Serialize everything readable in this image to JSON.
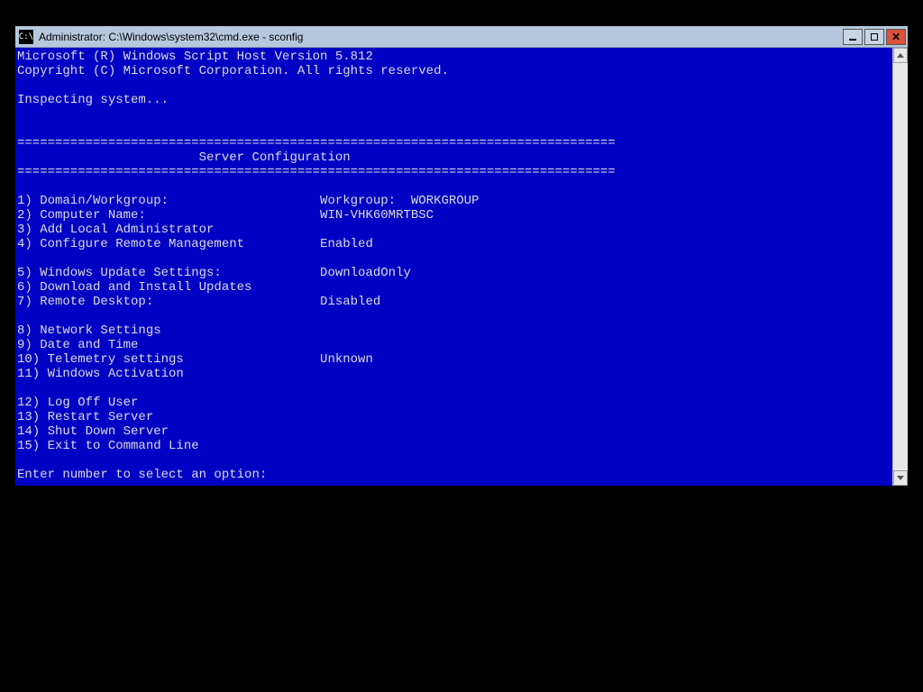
{
  "window": {
    "title": "Administrator: C:\\Windows\\system32\\cmd.exe - sconfig",
    "icon_label": "C:\\"
  },
  "header": {
    "line1": "Microsoft (R) Windows Script Host Version 5.812",
    "line2": "Copyright (C) Microsoft Corporation. All rights reserved."
  },
  "inspecting": "Inspecting system...",
  "divider": "===============================================================================",
  "banner_title_padded": "                        Server Configuration",
  "menu": [
    {
      "num": "1",
      "label": "Domain/Workgroup:",
      "value": "Workgroup:  WORKGROUP"
    },
    {
      "num": "2",
      "label": "Computer Name:",
      "value": "WIN-VHK60MRTBSC"
    },
    {
      "num": "3",
      "label": "Add Local Administrator",
      "value": ""
    },
    {
      "num": "4",
      "label": "Configure Remote Management",
      "value": "Enabled"
    },
    {
      "num": "",
      "label": "",
      "value": ""
    },
    {
      "num": "5",
      "label": "Windows Update Settings:",
      "value": "DownloadOnly"
    },
    {
      "num": "6",
      "label": "Download and Install Updates",
      "value": ""
    },
    {
      "num": "7",
      "label": "Remote Desktop:",
      "value": "Disabled"
    },
    {
      "num": "",
      "label": "",
      "value": ""
    },
    {
      "num": "8",
      "label": "Network Settings",
      "value": ""
    },
    {
      "num": "9",
      "label": "Date and Time",
      "value": ""
    },
    {
      "num": "10",
      "label": "Telemetry settings",
      "value": "Unknown"
    },
    {
      "num": "11",
      "label": "Windows Activation",
      "value": ""
    },
    {
      "num": "",
      "label": "",
      "value": ""
    },
    {
      "num": "12",
      "label": "Log Off User",
      "value": ""
    },
    {
      "num": "13",
      "label": "Restart Server",
      "value": ""
    },
    {
      "num": "14",
      "label": "Shut Down Server",
      "value": ""
    },
    {
      "num": "15",
      "label": "Exit to Command Line",
      "value": ""
    }
  ],
  "prompt": "Enter number to select an option: "
}
